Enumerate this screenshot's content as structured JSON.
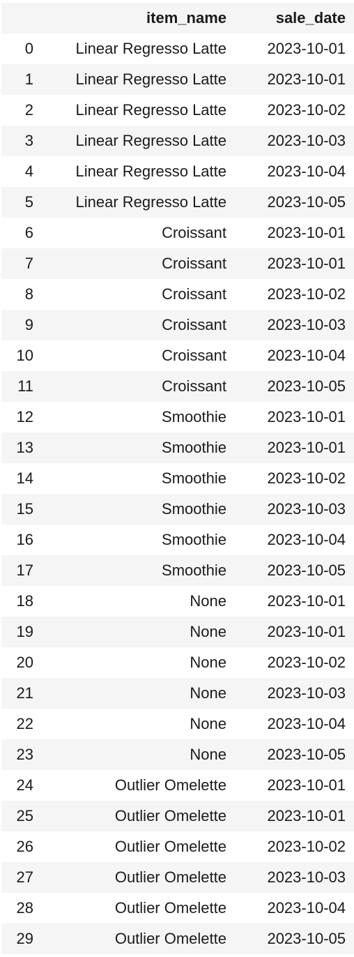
{
  "table": {
    "columns": [
      "",
      "item_name",
      "sale_date"
    ],
    "rows": [
      {
        "index": "0",
        "item_name": "Linear Regresso Latte",
        "sale_date": "2023-10-01"
      },
      {
        "index": "1",
        "item_name": "Linear Regresso Latte",
        "sale_date": "2023-10-01"
      },
      {
        "index": "2",
        "item_name": "Linear Regresso Latte",
        "sale_date": "2023-10-02"
      },
      {
        "index": "3",
        "item_name": "Linear Regresso Latte",
        "sale_date": "2023-10-03"
      },
      {
        "index": "4",
        "item_name": "Linear Regresso Latte",
        "sale_date": "2023-10-04"
      },
      {
        "index": "5",
        "item_name": "Linear Regresso Latte",
        "sale_date": "2023-10-05"
      },
      {
        "index": "6",
        "item_name": "Croissant",
        "sale_date": "2023-10-01"
      },
      {
        "index": "7",
        "item_name": "Croissant",
        "sale_date": "2023-10-01"
      },
      {
        "index": "8",
        "item_name": "Croissant",
        "sale_date": "2023-10-02"
      },
      {
        "index": "9",
        "item_name": "Croissant",
        "sale_date": "2023-10-03"
      },
      {
        "index": "10",
        "item_name": "Croissant",
        "sale_date": "2023-10-04"
      },
      {
        "index": "11",
        "item_name": "Croissant",
        "sale_date": "2023-10-05"
      },
      {
        "index": "12",
        "item_name": "Smoothie",
        "sale_date": "2023-10-01"
      },
      {
        "index": "13",
        "item_name": "Smoothie",
        "sale_date": "2023-10-01"
      },
      {
        "index": "14",
        "item_name": "Smoothie",
        "sale_date": "2023-10-02"
      },
      {
        "index": "15",
        "item_name": "Smoothie",
        "sale_date": "2023-10-03"
      },
      {
        "index": "16",
        "item_name": "Smoothie",
        "sale_date": "2023-10-04"
      },
      {
        "index": "17",
        "item_name": "Smoothie",
        "sale_date": "2023-10-05"
      },
      {
        "index": "18",
        "item_name": "None",
        "sale_date": "2023-10-01"
      },
      {
        "index": "19",
        "item_name": "None",
        "sale_date": "2023-10-01"
      },
      {
        "index": "20",
        "item_name": "None",
        "sale_date": "2023-10-02"
      },
      {
        "index": "21",
        "item_name": "None",
        "sale_date": "2023-10-03"
      },
      {
        "index": "22",
        "item_name": "None",
        "sale_date": "2023-10-04"
      },
      {
        "index": "23",
        "item_name": "None",
        "sale_date": "2023-10-05"
      },
      {
        "index": "24",
        "item_name": "Outlier Omelette",
        "sale_date": "2023-10-01"
      },
      {
        "index": "25",
        "item_name": "Outlier Omelette",
        "sale_date": "2023-10-01"
      },
      {
        "index": "26",
        "item_name": "Outlier Omelette",
        "sale_date": "2023-10-02"
      },
      {
        "index": "27",
        "item_name": "Outlier Omelette",
        "sale_date": "2023-10-03"
      },
      {
        "index": "28",
        "item_name": "Outlier Omelette",
        "sale_date": "2023-10-04"
      },
      {
        "index": "29",
        "item_name": "Outlier Omelette",
        "sale_date": "2023-10-05"
      }
    ]
  }
}
